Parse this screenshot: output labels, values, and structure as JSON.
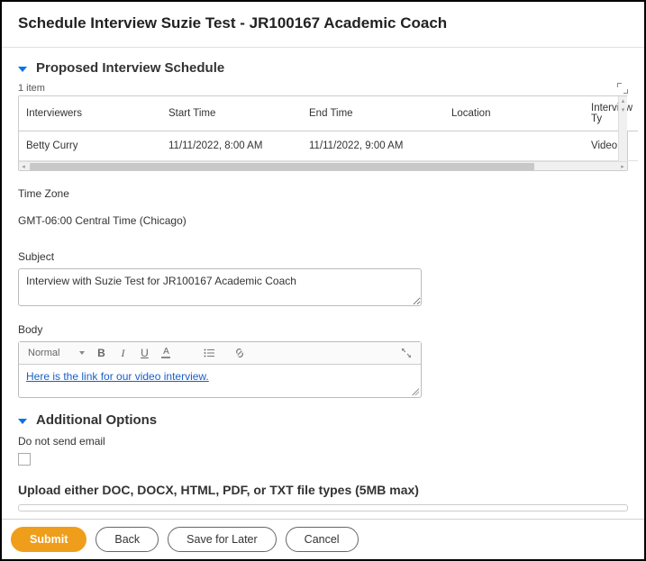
{
  "page": {
    "title": "Schedule Interview Suzie Test - JR100167 Academic Coach"
  },
  "proposed": {
    "section_title": "Proposed Interview Schedule",
    "item_count_label": "1 item",
    "columns": {
      "interviewers": "Interviewers",
      "start_time": "Start Time",
      "end_time": "End Time",
      "location": "Location",
      "interview_type": "Interview Ty"
    },
    "rows": [
      {
        "interviewers": "Betty Curry",
        "start_time": "11/11/2022, 8:00 AM",
        "end_time": "11/11/2022, 9:00 AM",
        "location": "",
        "interview_type": "Video"
      }
    ]
  },
  "timezone": {
    "label": "Time Zone",
    "value": "GMT-06:00 Central Time (Chicago)"
  },
  "subject": {
    "label": "Subject",
    "value": "Interview with Suzie Test for JR100167 Academic Coach"
  },
  "body": {
    "label": "Body",
    "format_label": "Normal",
    "content_link": "Here is the link for our video interview."
  },
  "additional": {
    "section_title": "Additional Options",
    "do_not_send_label": "Do not send email"
  },
  "upload": {
    "label": "Upload either DOC, DOCX, HTML, PDF, or TXT file types (5MB max)"
  },
  "footer": {
    "submit": "Submit",
    "back": "Back",
    "save_for_later": "Save for Later",
    "cancel": "Cancel"
  }
}
